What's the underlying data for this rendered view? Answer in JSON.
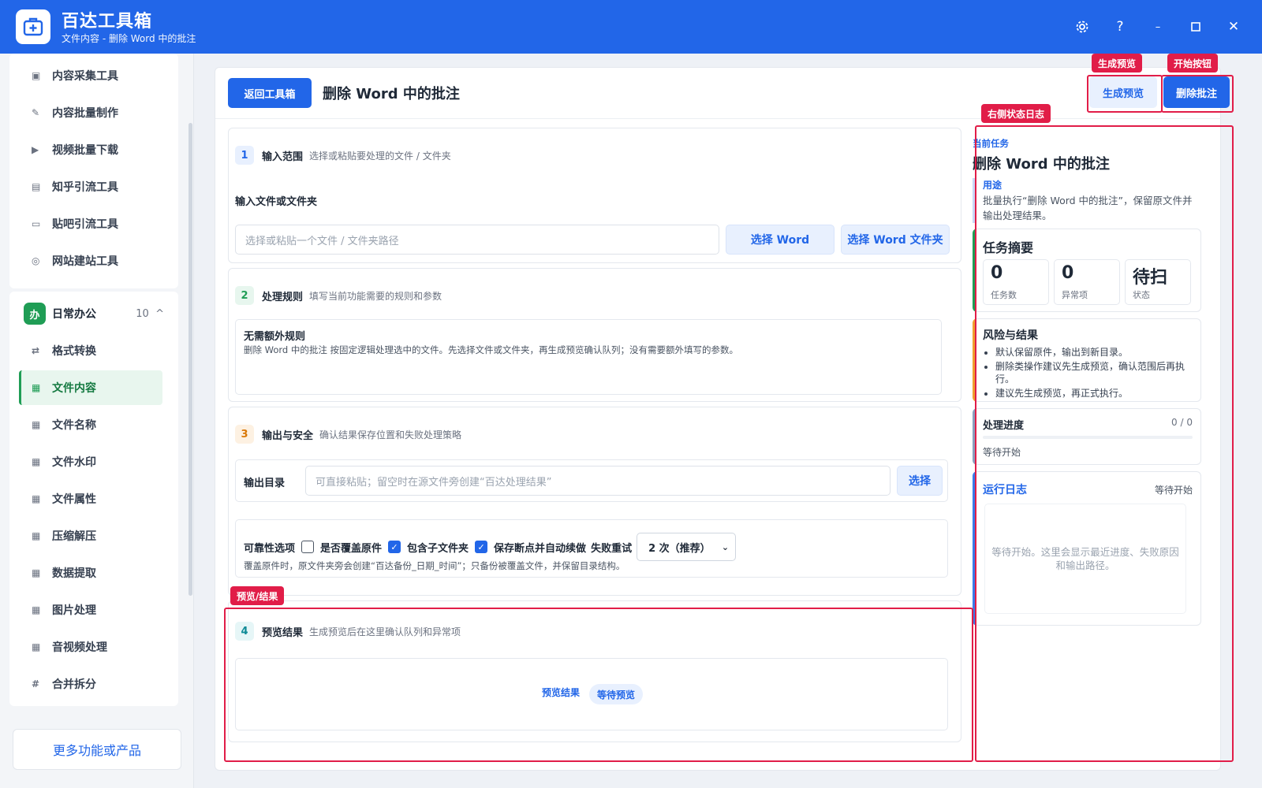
{
  "app": {
    "title": "百达工具箱",
    "subtitle": "文件内容 - 删除 Word 中的批注"
  },
  "sidebar": {
    "top_items": [
      {
        "label": "内容采集工具",
        "icon": "clipboard-icon"
      },
      {
        "label": "内容批量制作",
        "icon": "pen-icon"
      },
      {
        "label": "视频批量下载",
        "icon": "video-icon"
      },
      {
        "label": "知乎引流工具",
        "icon": "doc-icon"
      },
      {
        "label": "贴吧引流工具",
        "icon": "chat-icon"
      },
      {
        "label": "网站建站工具",
        "icon": "globe-icon"
      }
    ],
    "group": {
      "badge": "办",
      "label": "日常办公",
      "count": "10",
      "chevron": "^"
    },
    "group_items": [
      {
        "label": "格式转换",
        "icon": "swap-icon"
      },
      {
        "label": "文件内容",
        "icon": "grid-icon",
        "active": true
      },
      {
        "label": "文件名称",
        "icon": "grid-icon"
      },
      {
        "label": "文件水印",
        "icon": "grid-icon"
      },
      {
        "label": "文件属性",
        "icon": "grid-icon"
      },
      {
        "label": "压缩解压",
        "icon": "grid-icon"
      },
      {
        "label": "数据提取",
        "icon": "grid-icon"
      },
      {
        "label": "图片处理",
        "icon": "grid-icon"
      },
      {
        "label": "音视频处理",
        "icon": "grid-icon"
      },
      {
        "label": "合并拆分",
        "icon": "hash-icon"
      }
    ],
    "more": "更多功能或产品"
  },
  "header": {
    "back": "返回工具箱",
    "title": "删除 Word 中的批注",
    "preview_btn": "生成预览",
    "start_btn": "删除批注"
  },
  "section1": {
    "num": "1",
    "title": "输入范围",
    "desc": "选择或粘贴要处理的文件 / 文件夹",
    "field_label": "输入文件或文件夹",
    "placeholder": "选择或粘贴一个文件 / 文件夹路径",
    "btn_word": "选择 Word",
    "btn_folder": "选择 Word 文件夹"
  },
  "section2": {
    "num": "2",
    "title": "处理规则",
    "desc": "填写当前功能需要的规则和参数",
    "rule_title": "无需额外规则",
    "rule_desc": "删除 Word 中的批注 按固定逻辑处理选中的文件。先选择文件或文件夹，再生成预览确认队列；没有需要额外填写的参数。"
  },
  "section3": {
    "num": "3",
    "title": "输出与安全",
    "desc": "确认结果保存位置和失败处理策略",
    "output_label": "输出目录",
    "output_placeholder": "可直接粘贴；留空时在源文件旁创建“百达处理结果”",
    "output_btn": "选择",
    "options_label": "可靠性选项",
    "opt_overwrite": "是否覆盖原件",
    "opt_subfolder": "包含子文件夹",
    "opt_resume": "保存断点并自动续做",
    "retry_label": "失败重试",
    "retry_value": "2 次（推荐）",
    "note": "覆盖原件时，原文件夹旁会创建“百达备份_日期_时间”；只备份被覆盖文件，并保留目录结构。"
  },
  "section4": {
    "num": "4",
    "title": "预览结果",
    "desc": "生成预览后在这里确认队列和异常项",
    "preview_label": "预览结果",
    "status_pill": "等待预览"
  },
  "right": {
    "label": "当前任务",
    "title": "删除 Word 中的批注",
    "usage_h": "用途",
    "usage_t": "批量执行“删除 Word 中的批注”，保留原文件并输出处理结果。",
    "summary_h": "任务摘要",
    "stats": [
      {
        "value": "0",
        "label": "任务数"
      },
      {
        "value": "0",
        "label": "异常项"
      },
      {
        "value": "待扫",
        "label": "状态"
      }
    ],
    "risk_h": "风险与结果",
    "risks": [
      "默认保留原件，输出到新目录。",
      "删除类操作建议先生成预览，确认范围后再执行。",
      "建议先生成预览，再正式执行。"
    ],
    "progress_h": "处理进度",
    "progress_v": "0 / 0",
    "progress_fraction": 0,
    "progress_s": "等待开始",
    "log_h": "运行日志",
    "log_s": "等待开始",
    "log_body": "等待开始。这里会显示最近进度、失败原因和输出路径。"
  },
  "annotations": {
    "preview": "生成预览",
    "start": "开始按钮",
    "status_log": "右侧状态日志",
    "result": "预览/结果"
  },
  "colors": {
    "brand": "#2266e8",
    "active_green": "#1f9d55",
    "annotation_red": "#e11d48"
  }
}
